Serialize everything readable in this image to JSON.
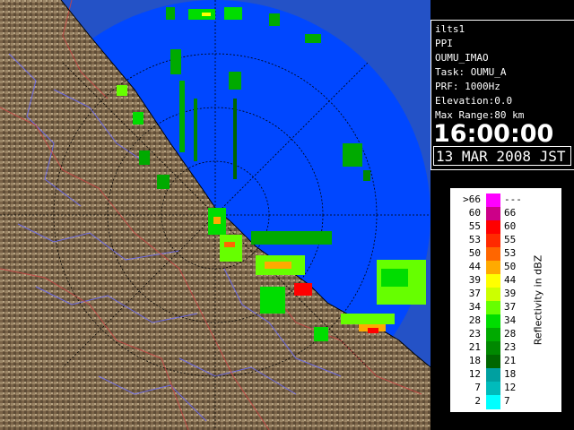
{
  "info": {
    "radar": "ilts1",
    "mode": "PPI",
    "site": "OUMU_IMAO",
    "task": "Task: OUMU_A",
    "prf": "PRF: 1000Hz",
    "elevation": "Elevation:0.0",
    "max_range": "Max Range:80 km",
    "time": "16:00:00",
    "date": "13 MAR 2008 JST"
  },
  "legend": {
    "title": "Reflectivity in dBZ",
    "levels": [
      {
        "low": ">66",
        "high": "---",
        "color": "#ff00ff"
      },
      {
        "low": "60",
        "high": "66",
        "color": "#cc0088"
      },
      {
        "low": "55",
        "high": "60",
        "color": "#ff0000"
      },
      {
        "low": "53",
        "high": "55",
        "color": "#ff2a00"
      },
      {
        "low": "50",
        "high": "53",
        "color": "#ff6600"
      },
      {
        "low": "44",
        "high": "50",
        "color": "#ffaa00"
      },
      {
        "low": "39",
        "high": "44",
        "color": "#ffff00"
      },
      {
        "low": "37",
        "high": "39",
        "color": "#ccff00"
      },
      {
        "low": "34",
        "high": "37",
        "color": "#66ff00"
      },
      {
        "low": "28",
        "high": "34",
        "color": "#00dd00"
      },
      {
        "low": "23",
        "high": "28",
        "color": "#00aa00"
      },
      {
        "low": "21",
        "high": "23",
        "color": "#008800"
      },
      {
        "low": "18",
        "high": "21",
        "color": "#006600"
      },
      {
        "low": "12",
        "high": "18",
        "color": "#00a0a0"
      },
      {
        "low": "7",
        "high": "12",
        "color": "#00bbbb"
      },
      {
        "low": "2",
        "high": "7",
        "color": "#00ffff"
      }
    ]
  },
  "colors": {
    "sea": "#0047ff",
    "outer_sea": "#2452c6",
    "land": "#7d6a50"
  }
}
